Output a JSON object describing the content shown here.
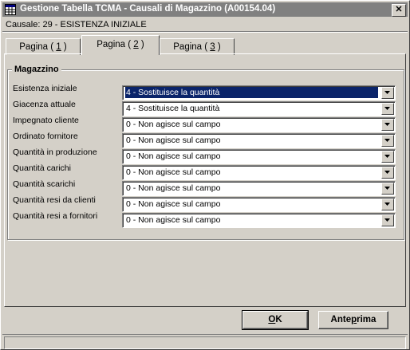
{
  "window": {
    "title": "Gestione Tabella TCMA - Causali di Magazzino (A00154.04)",
    "close_glyph": "✕"
  },
  "causale": "Causale: 29 - ESISTENZA INIZIALE",
  "tabs": [
    {
      "prefix": "Pagina ( ",
      "key": "1",
      "suffix": " )",
      "active": false
    },
    {
      "prefix": "Pagina ( ",
      "key": "2",
      "suffix": " )",
      "active": true
    },
    {
      "prefix": "Pagina ( ",
      "key": "3",
      "suffix": " )",
      "active": false
    }
  ],
  "group": {
    "title": "Magazzino",
    "rows": [
      {
        "label": "Esistenza iniziale",
        "value": "4 - Sostituisce la quantità",
        "selected": true
      },
      {
        "label": "Giacenza attuale",
        "value": "4 - Sostituisce la quantità",
        "selected": false
      },
      {
        "label": "Impegnato cliente",
        "value": "0 - Non agisce sul campo",
        "selected": false
      },
      {
        "label": "Ordinato fornitore",
        "value": "0 - Non agisce sul campo",
        "selected": false
      },
      {
        "label": "Quantità in produzione",
        "value": "0 - Non agisce sul campo",
        "selected": false
      },
      {
        "label": "Quantità carichi",
        "value": "0 - Non agisce sul campo",
        "selected": false
      },
      {
        "label": "Quantità scarichi",
        "value": "0 - Non agisce sul campo",
        "selected": false
      },
      {
        "label": "Quantità resi da clienti",
        "value": "0 - Non agisce sul campo",
        "selected": false
      },
      {
        "label": "Quantità resi a fornitori",
        "value": "0 - Non agisce sul campo",
        "selected": false
      }
    ]
  },
  "buttons": {
    "ok": {
      "key": "O",
      "rest": "K"
    },
    "anteprima": {
      "pre": "Ante",
      "key": "p",
      "rest": "rima"
    }
  },
  "colors": {
    "face": "#d4d0c8",
    "titlebar": "#808080",
    "selection": "#0a246a"
  },
  "icons": {
    "window": "table-grid-icon",
    "dropdown": "triangle-down-icon"
  }
}
